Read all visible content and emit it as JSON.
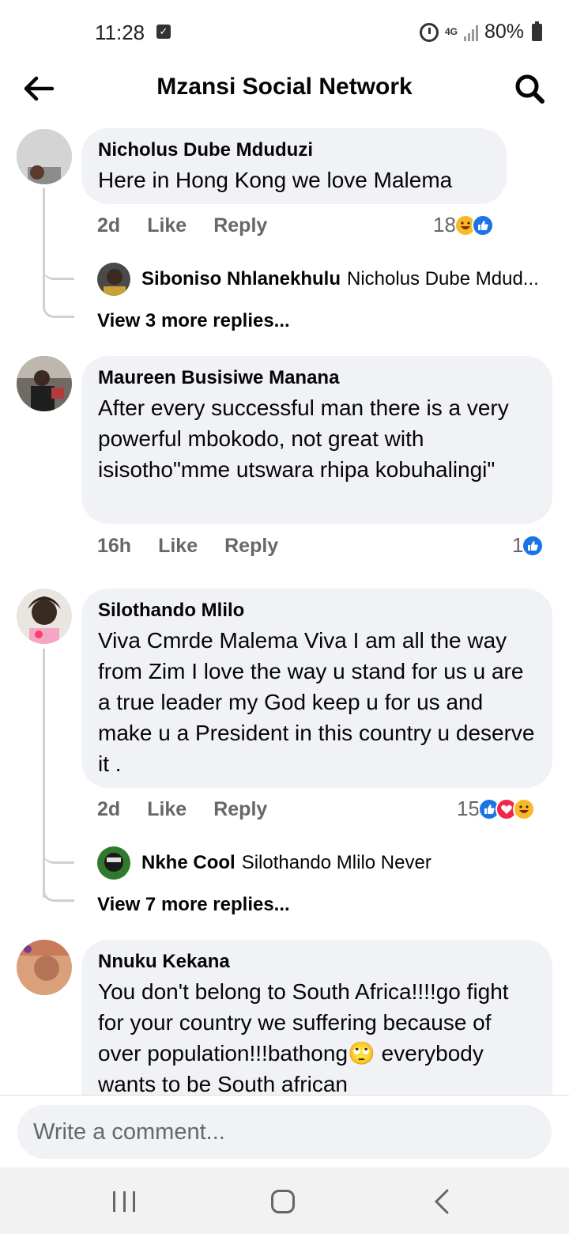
{
  "status_bar": {
    "time": "11:28",
    "network": "4G",
    "battery": "80%"
  },
  "header": {
    "title": "Mzansi Social Network"
  },
  "comments": [
    {
      "author": "Nicholus Dube Mduduzi",
      "text": "Here in Hong Kong we love Malema",
      "time": "2d",
      "like": "Like",
      "reply": "Reply",
      "reaction_count": "18",
      "reactions": [
        "haha-icon",
        "like-icon"
      ],
      "reply_preview": {
        "author": "Siboniso Nhlanekhulu",
        "text": "Nicholus Dube Mdud..."
      },
      "view_more": "View 3 more replies..."
    },
    {
      "author": "Maureen Busisiwe Manana",
      "text": "After every successful man there is a very powerful mbokodo, not great with isisotho\"mme utswara rhipa kobuhalingi\"",
      "time": "16h",
      "like": "Like",
      "reply": "Reply",
      "reaction_count": "1",
      "reactions": [
        "like-icon"
      ]
    },
    {
      "author": "Silothando Mlilo",
      "text": "Viva Cmrde Malema  Viva I am all the way from Zim  I love the way u stand for us u are a true leader my God keep u for us and make u a President in this country u deserve it .",
      "time": "2d",
      "like": "Like",
      "reply": "Reply",
      "reaction_count": "15",
      "reactions": [
        "like-icon",
        "love-icon",
        "haha-icon"
      ],
      "reply_preview": {
        "author": "Nkhe Cool",
        "text": "Silothando Mlilo Never"
      },
      "view_more": "View 7 more replies..."
    },
    {
      "author": "Nnuku Kekana",
      "text": "You don't belong to South Africa!!!!go fight for your country we suffering because of over population!!!bathong🙄 everybody wants to be South african"
    }
  ],
  "composer": {
    "placeholder": "Write a comment..."
  },
  "colors": {
    "like": "#1b74e4",
    "love": "#f0284a",
    "haha": "#f7b928",
    "bubble": "#f0f2f5",
    "meta": "#65676b"
  }
}
